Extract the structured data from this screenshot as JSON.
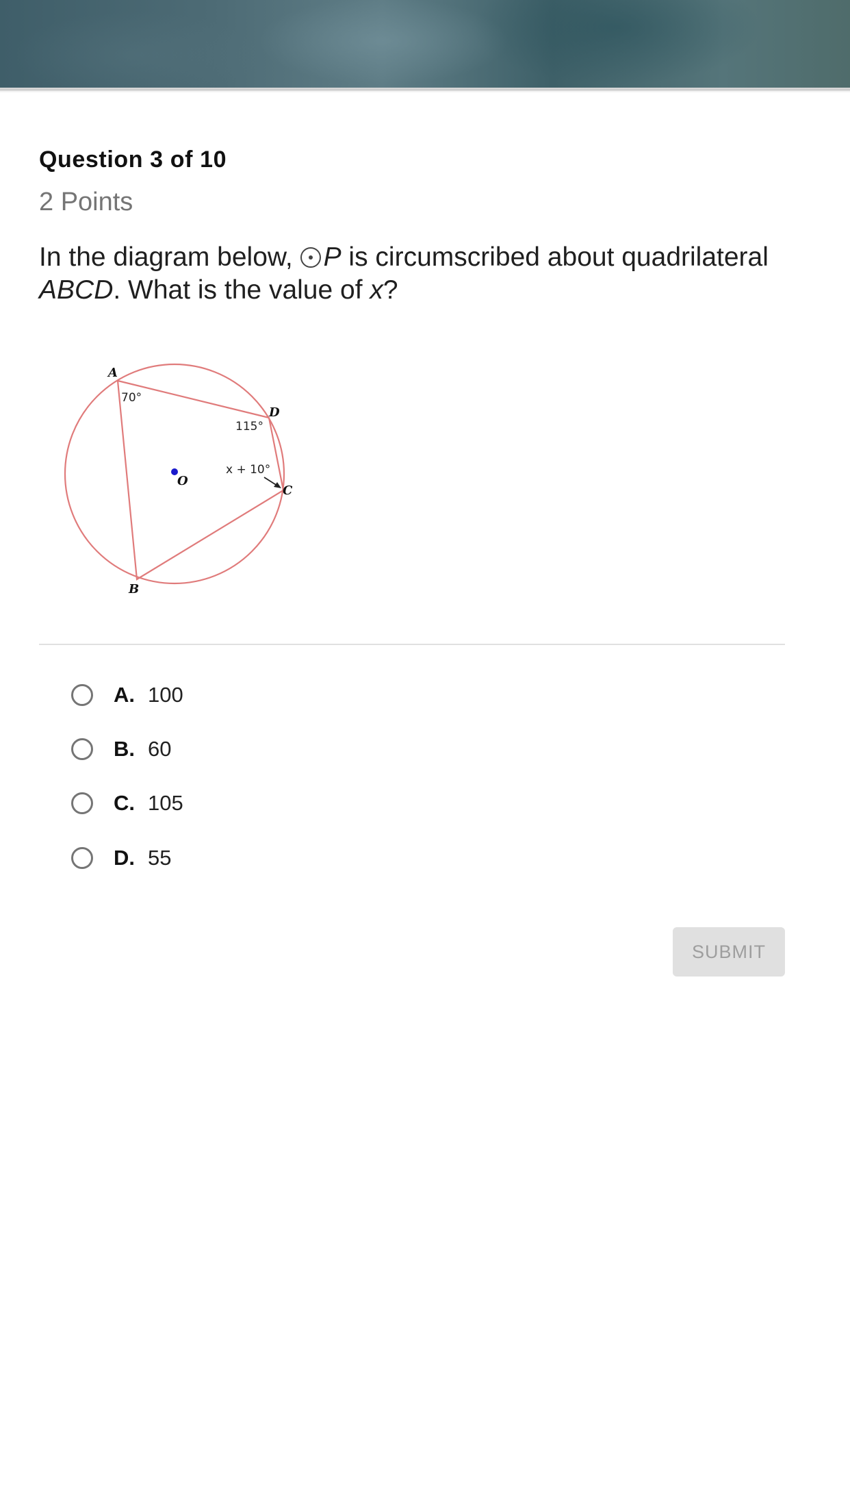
{
  "question": {
    "number_label": "Question 3 of 10",
    "points_label": "2 Points",
    "prompt": {
      "part1": "In the diagram below, ",
      "circle_name": "P",
      "part2": " is circumscribed about quadrilateral ",
      "quad_name": "ABCD",
      "part3": ". What is the value of ",
      "variable": "x",
      "part4": "?"
    }
  },
  "diagram": {
    "vertices": {
      "a": "A",
      "b": "B",
      "c": "C",
      "d": "D",
      "center": "O"
    },
    "angles": {
      "a": "70°",
      "d": "115°",
      "c": "x + 10°"
    },
    "colors": {
      "lines": "#e07b7b",
      "center_point": "#1a1acc"
    }
  },
  "options": [
    {
      "letter": "A.",
      "value": "100"
    },
    {
      "letter": "B.",
      "value": "60"
    },
    {
      "letter": "C.",
      "value": "105"
    },
    {
      "letter": "D.",
      "value": "55"
    }
  ],
  "submit": {
    "label": "SUBMIT"
  },
  "colors": {
    "submit_bg": "#e0e0e0",
    "submit_text": "#9e9e9e",
    "divider": "#e0e0e0"
  }
}
